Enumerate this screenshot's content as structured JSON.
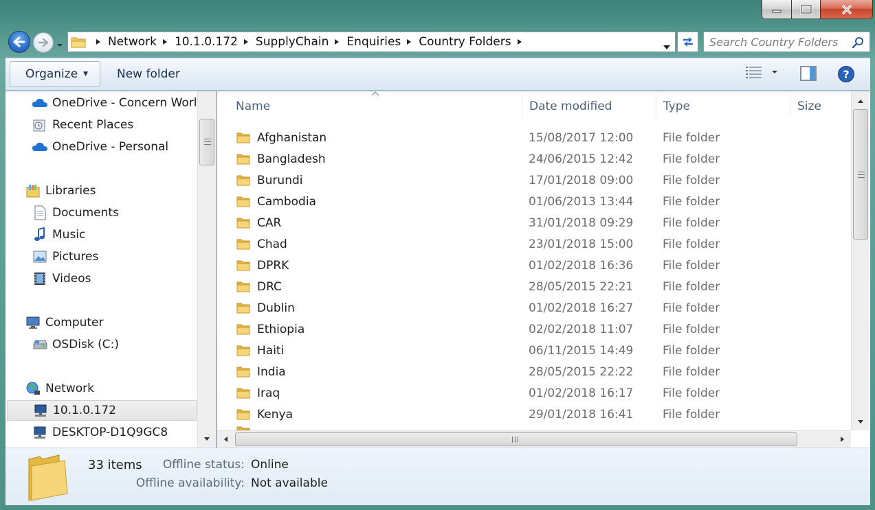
{
  "window": {
    "colors": {
      "accent": "#3b8278",
      "close": "#c8442c",
      "header_text": "#4c607a",
      "meta_text": "#6d6d6d"
    }
  },
  "address": {
    "crumbs": [
      "Network",
      "10.1.0.172",
      "SupplyChain",
      "Enquiries",
      "Country Folders"
    ],
    "search_placeholder": "Search Country Folders"
  },
  "toolbar": {
    "organize_label": "Organize",
    "new_folder_label": "New folder",
    "views_icon": "details-view-icon",
    "preview_icon": "preview-pane-icon",
    "help_icon": "help-icon"
  },
  "nav": {
    "items": [
      {
        "label": "OneDrive - Concern World",
        "icon": "onedrive-icon"
      },
      {
        "label": "Recent Places",
        "icon": "recent-places-icon"
      },
      {
        "label": "OneDrive - Personal",
        "icon": "onedrive-icon"
      },
      {
        "label": "Libraries",
        "icon": "libraries-icon"
      },
      {
        "label": "Documents",
        "icon": "documents-icon"
      },
      {
        "label": "Music",
        "icon": "music-icon"
      },
      {
        "label": "Pictures",
        "icon": "pictures-icon"
      },
      {
        "label": "Videos",
        "icon": "videos-icon"
      },
      {
        "label": "Computer",
        "icon": "computer-icon"
      },
      {
        "label": "OSDisk (C:)",
        "icon": "drive-icon"
      },
      {
        "label": "Network",
        "icon": "network-icon"
      },
      {
        "label": "10.1.0.172",
        "icon": "network-computer-icon",
        "selected": true
      },
      {
        "label": "DESKTOP-D1Q9GC8",
        "icon": "network-computer-icon"
      }
    ]
  },
  "columns": [
    "Name",
    "Date modified",
    "Type",
    "Size"
  ],
  "files": [
    {
      "name": "Afghanistan",
      "date": "15/08/2017 12:00",
      "type": "File folder"
    },
    {
      "name": "Bangladesh",
      "date": "24/06/2015 12:42",
      "type": "File folder"
    },
    {
      "name": "Burundi",
      "date": "17/01/2018 09:00",
      "type": "File folder"
    },
    {
      "name": "Cambodia",
      "date": "01/06/2013 13:44",
      "type": "File folder"
    },
    {
      "name": "CAR",
      "date": "31/01/2018 09:29",
      "type": "File folder"
    },
    {
      "name": "Chad",
      "date": "23/01/2018 15:00",
      "type": "File folder"
    },
    {
      "name": "DPRK",
      "date": "01/02/2018 16:36",
      "type": "File folder"
    },
    {
      "name": "DRC",
      "date": "28/05/2015 22:21",
      "type": "File folder"
    },
    {
      "name": "Dublin",
      "date": "01/02/2018 16:27",
      "type": "File folder"
    },
    {
      "name": "Ethiopia",
      "date": "02/02/2018 11:07",
      "type": "File folder"
    },
    {
      "name": "Haiti",
      "date": "06/11/2015 14:49",
      "type": "File folder"
    },
    {
      "name": "India",
      "date": "28/05/2015 22:22",
      "type": "File folder"
    },
    {
      "name": "Iraq",
      "date": "01/02/2018 16:17",
      "type": "File folder"
    },
    {
      "name": "Kenya",
      "date": "29/01/2018 16:41",
      "type": "File folder"
    }
  ],
  "details": {
    "count": "33 items",
    "offline_status_label": "Offline status:",
    "offline_status_value": "Online",
    "offline_avail_label": "Offline availability:",
    "offline_avail_value": "Not available"
  }
}
